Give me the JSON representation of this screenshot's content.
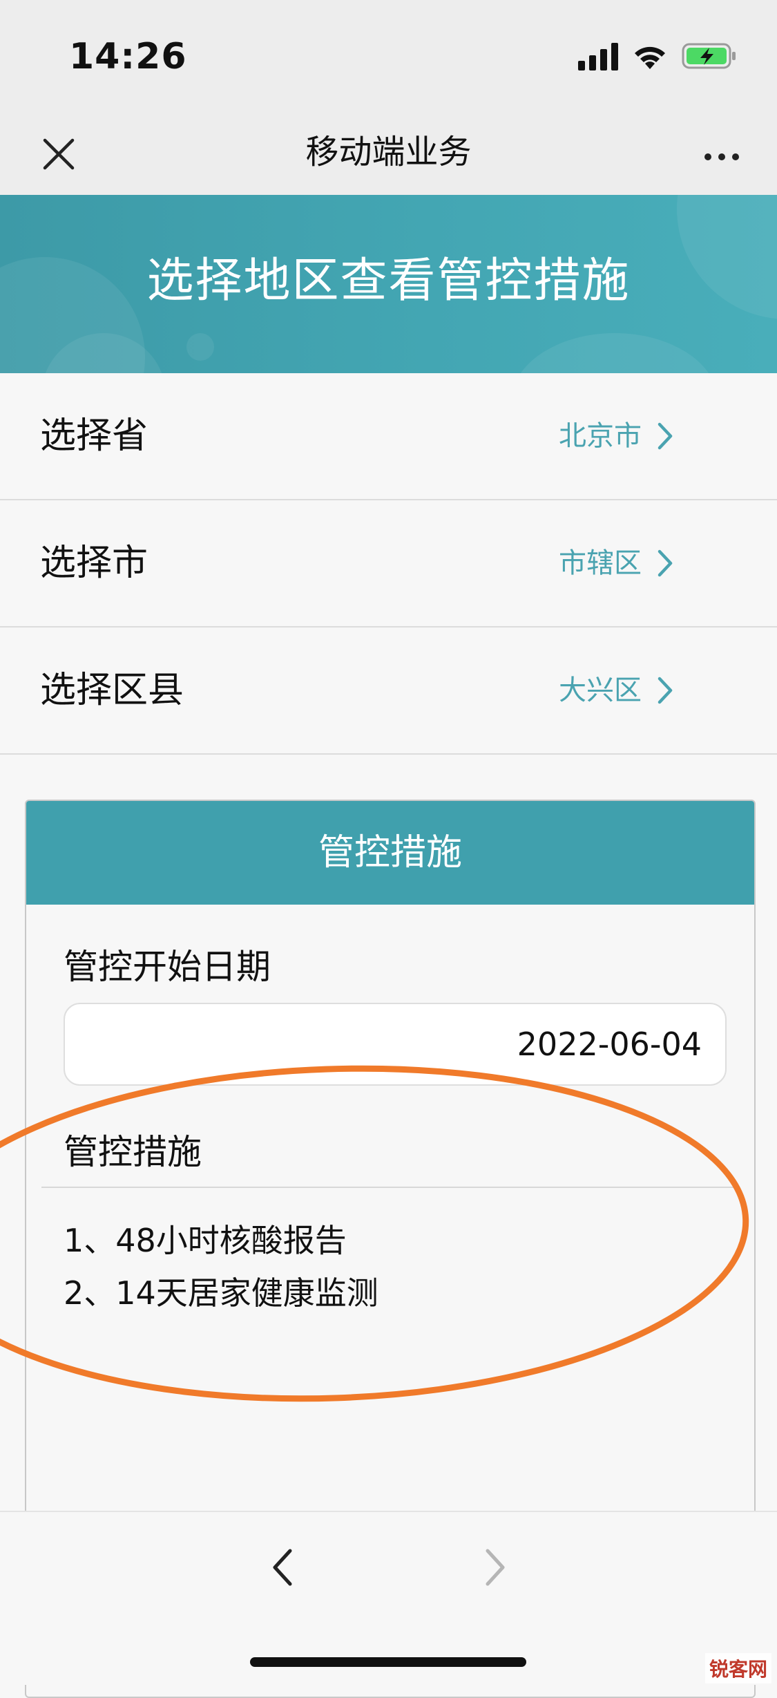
{
  "status_bar": {
    "time": "14:26"
  },
  "nav": {
    "title": "移动端业务"
  },
  "banner": {
    "title": "选择地区查看管控措施"
  },
  "selectors": [
    {
      "label": "选择省",
      "value": "北京市"
    },
    {
      "label": "选择市",
      "value": "市辖区"
    },
    {
      "label": "选择区县",
      "value": "大兴区"
    }
  ],
  "card": {
    "title": "管控措施",
    "start_date_label": "管控开始日期",
    "start_date_value": "2022-06-04",
    "measures_label": "管控措施",
    "measures": [
      "1、48小时核酸报告",
      "2、14天居家健康监测"
    ]
  },
  "colors": {
    "accent": "#40a0ad",
    "value_text": "#4aa3b0",
    "annotation": "#f07a2a",
    "battery": "#4cd964"
  },
  "watermark": "锐客网"
}
